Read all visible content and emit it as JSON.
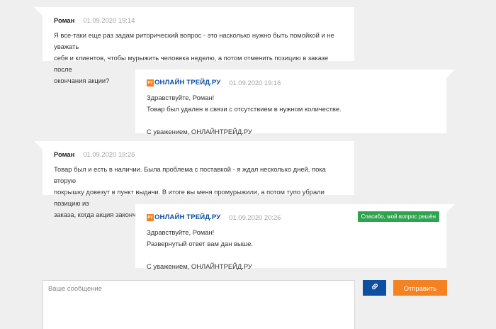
{
  "messages": [
    {
      "author": "Роман",
      "date": "01.09.2020 19:14",
      "lines": [
        "Я все-таки еще раз задам риторический вопрос - это насколько нужно быть помойкой и не уважать",
        "себя и клиентов, чтобы мурыжить человека неделю, а потом отменить позицию в заказе после",
        "окончания акции?"
      ]
    },
    {
      "logo_badge": "РУ",
      "logo_text": "ОНЛАЙН ТРЕЙД.РУ",
      "date": "01.09.2020 19:16",
      "greeting": "Здравствуйте, Роман!",
      "text": "Товар был удален в связи с отсутствием в нужном количестве.",
      "signature": "С уважением, ОНЛАЙНТРЕЙД.РУ"
    },
    {
      "author": "Роман",
      "date": "01.09.2020 19:26",
      "lines": [
        "Товар был и есть в наличии. Была проблема с поставкой - я ждал несколько дней, пока вторую",
        "покрышку довезут в пункт выдачи. В итоге вы меня промурыжили, а потом тупо убрали позицию из",
        "заказа, когда акция закончилась и цена выросла."
      ]
    },
    {
      "logo_badge": "РУ",
      "logo_text": "ОНЛАЙН ТРЕЙД.РУ",
      "date": "01.09.2020 20:26",
      "greeting": "Здравствуйте, Роман!",
      "text": "Развернутый ответ вам дан выше.",
      "signature": "С уважением, ОНЛАЙНТРЕЙД.РУ",
      "badge": "Спасибо, мой вопрос решён"
    }
  ],
  "composer": {
    "placeholder": "Ваше сообщение",
    "attach_icon": "paperclip-icon",
    "send_label": "Отправить"
  },
  "colors": {
    "brand_blue": "#0d4fa0",
    "brand_orange": "#f58220",
    "solved_green": "#2ea44f",
    "background": "#efefef"
  }
}
